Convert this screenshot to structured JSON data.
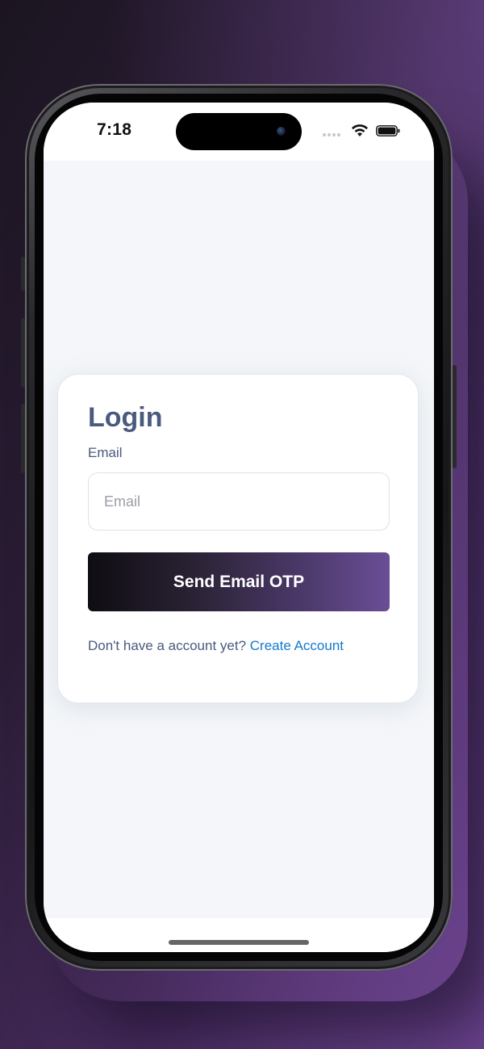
{
  "status_bar": {
    "time": "7:18",
    "icons": [
      "signal-dots-icon",
      "wifi-icon",
      "battery-icon"
    ]
  },
  "login": {
    "title": "Login",
    "email_label": "Email",
    "email_placeholder": "Email",
    "email_value": "",
    "submit_label": "Send Email OTP",
    "signup_prompt": "Don't have a account yet?",
    "signup_link": "Create Account"
  },
  "colors": {
    "title": "#4a5a7e",
    "link": "#1479d0",
    "button_gradient_start": "#0f0d13",
    "button_gradient_end": "#6a4e96",
    "background": "#f4f6f9"
  }
}
